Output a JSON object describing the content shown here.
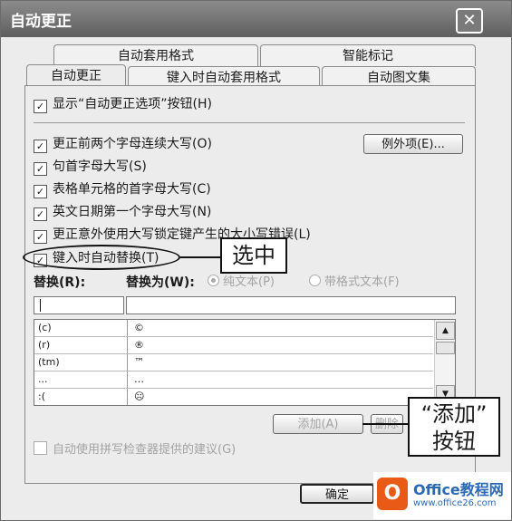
{
  "window": {
    "title": "自动更正",
    "close": "✕"
  },
  "tabs_back": [
    "自动套用格式",
    "智能标记"
  ],
  "tabs_front": [
    "自动更正",
    "键入时自动套用格式",
    "自动图文集"
  ],
  "options": {
    "show_buttons": "显示“自动更正选项”按钮(H)",
    "two_caps": "更正前两个字母连续大写(O)",
    "sentence_cap": "句首字母大写(S)",
    "table_cell_cap": "表格单元格的首字母大写(C)",
    "day_names": "英文日期第一个字母大写(N)",
    "caps_lock": "更正意外使用大写锁定键产生的大小写错误(L)",
    "replace_typing": "键入时自动替换(T)",
    "spellcheck": "自动使用拼写检查器提供的建议(G)"
  },
  "exceptions_button": "例外项(E)...",
  "replace_label": "替换(R):",
  "with_label": "替换为(W):",
  "radio_plain": "纯文本(P)",
  "radio_formatted": "带格式文本(F)",
  "list_rows": [
    {
      "from": "(c)",
      "to": "©"
    },
    {
      "from": "(r)",
      "to": "®"
    },
    {
      "from": "(tm)",
      "to": "™"
    },
    {
      "from": "...",
      "to": "…"
    },
    {
      "from": ":(",
      "to": "☹"
    }
  ],
  "buttons": {
    "add": "添加(A)",
    "delete": "删除",
    "ok": "确定"
  },
  "callouts": {
    "select": "选中",
    "add_line1": "“添加”",
    "add_line2": "按钮"
  },
  "watermark": {
    "logo": "O",
    "name": "Office教程网",
    "url": "www.office26.com"
  }
}
